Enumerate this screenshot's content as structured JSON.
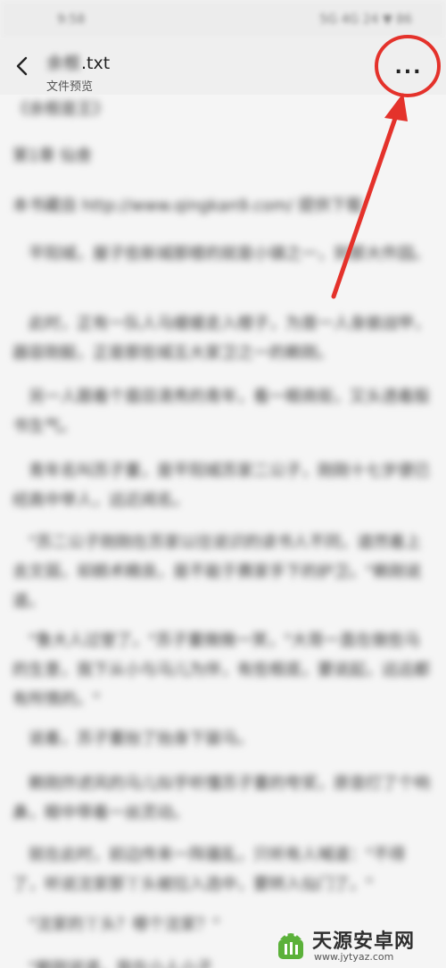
{
  "status_bar": {
    "time": "9:58",
    "system_indicators": "5G 4G 24 ▼ 86"
  },
  "header": {
    "title_blurred": "余根",
    "title_ext": ".txt",
    "subtitle": "文件预览",
    "more_label": "..."
  },
  "document": {
    "paragraphs": [
      "《余根是王》",
      "第1章 仙舍",
      "本书藏自 http://www.qingkan9.com/ 提供下载",
      "　平阳城，屋子些新城那楼的就是小镇之一，到那大件园。",
      "　此时，正有一队人马缓缓走入楼子，为首一人身披战甲，器容刚毅，正是那些城五大家卫之一的赖刚。",
      "　另一人跟着个眉目清秀的青年，看一眼商街，又头透着股书生气。",
      "　青年名叫苏子董，是平阳城苏家二公子，刚刚十七岁便已经高中举人，远近闻名。",
      "　\"苏二公子刚刚在苏家以往说识的读书人不同，道然着上去文弱，却颇术精良，是不能于赛家手下的护卫。\"赖刚说道。",
      "　\"鲁大人过誉了。\"苏子董微微一笑，\"大哥一直在做些马的生意，我下从小与马儿为伴，有些根底，要说起，远远都有所情的。\"",
      "　说着，苏子董抬了抬身下骏马。",
      "　赖刚炸述风的马儿似乎听懂苏子董的夸奖，原音打了个响鼻，眼中带着一丝灵动。",
      "　就在此时，前边传来一阵骚乱，只听有人喊道：\"不得了，听说沈家那丫头被拉入选中，要转入仙门了。\"",
      "　\"沈家的丫头？哪个沈家？\"",
      "　\"赖刚说道，我在小人小子"
    ]
  },
  "watermark": {
    "name": "天源安卓网",
    "url": "www.jytyaz.com"
  },
  "colors": {
    "annotation": "#e4322b",
    "background": "#f5f5f5",
    "header_bg": "#efefef"
  }
}
